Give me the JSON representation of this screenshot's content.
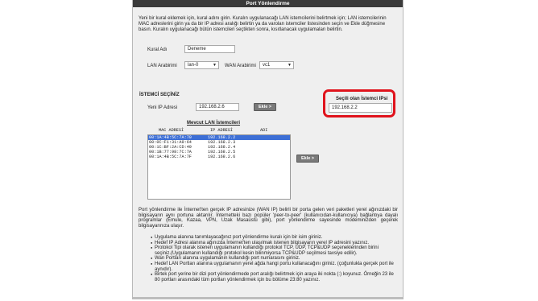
{
  "window": {
    "title": "Port Yönlendirme"
  },
  "intro": "Yeni bir kural eklemek için, kural adını girin. Kuralın uygulanacağı LAN istemcilerini belirtmek için; LAN istemcilerinin MAC adreslerini girin ya da bir IP adresi aralığı belirtin ya da varolan istemciler listesinden seçin ve Ekle düğmesine basın. Kuralın uygulanacağı bütün istemcileri seçtikten sonra, kısıtlanacak uygulamaları belirtin.",
  "form": {
    "rule_name_label": "Kural Adı",
    "rule_name_value": "Deneme",
    "lan_label": "LAN Arabirimi",
    "lan_value": "lan-0",
    "wan_label": "WAN Arabirimi",
    "wan_value": "vc1"
  },
  "client": {
    "section_title": "İSTEMCİ SEÇİNİZ",
    "new_ip_label": "Yeni IP Adresi",
    "new_ip_value": "192.168.2.6",
    "add_label": "Ekle >",
    "selected_title": "Seçili olan İstemci IPsi",
    "selected_value": "192.168.2.2",
    "list_title": "Mevcut LAN İstemcileri",
    "columns": [
      "MAC ADRESİ",
      "IP ADRESİ",
      "ADI"
    ],
    "rows": [
      {
        "mac": "00:1A:4B:5C:7A:70",
        "ip": "192.168.2.2",
        "selected": true
      },
      {
        "mac": "00:0C:F1:31:A9:64",
        "ip": "192.168.2.3",
        "selected": false
      },
      {
        "mac": "00:1C:BF:2A:CD:49",
        "ip": "192.168.2.4",
        "selected": false
      },
      {
        "mac": "00:1B:77:98:7C:7A",
        "ip": "192.168.2.5",
        "selected": false
      },
      {
        "mac": "00:1A:4B:5C:7A:7F",
        "ip": "192.168.2.6",
        "selected": false
      }
    ],
    "add_label_2": "Ekle >"
  },
  "help": {
    "paragraph": "Port yönlendirme ile İnternet'ten gerçek IP adresinize (WAN IP) belirli bir porta gelen veri paketleri yerel ağınızdaki bir bilgisayarın aynı portuna aktarılır. İnternetteki bazı popüler 'peer-to-peer' (kullanıcıdan-kullanıcıya) bağlantıya dayalı programlar (Emule, Kazaa, VPN, Uzak Masaüstü gibi), port yönlendirme sayesinde modeminizden geçerek bilgisayarınıza ulaşır.",
    "bullets": [
      "Uygulama alanına tanımlayacağınız port yönlendirme kuralı için bir isim giriniz.",
      "Hedef IP Adresi alanına ağınızda İnternet'ten ulaşılmak istenen bilgisayarın yerel IP adresini yazınız.",
      "Protokol Tipi olarak istenen uygulamanın kullandığı protokol TCP, UDP, TCP&UDP seçeneklerinden birini seçiniz.(Uygulamanın kullandığı protokol kesin bilinmiyorsa TCP&UDP seçilmesi tavsiye edilir).",
      "Wan Portları alanına uygulamanın kullandığı port numarasını giriniz.",
      "Hedef LAN Portları alanına uygulamanın yerel ağda hangi portu kullanacağını giriniz. (çoğunlukla gerçek port ile aynıdır).",
      "Birtek port yerine bir dizi port yönlendirmede port aralığı belirtmek için araya iki nokta (:) koyunuz. Örneğin 23 ile 80 portları arasındaki tüm portları yönlendirmek için bu bölüme 23:80 yazınız."
    ]
  }
}
